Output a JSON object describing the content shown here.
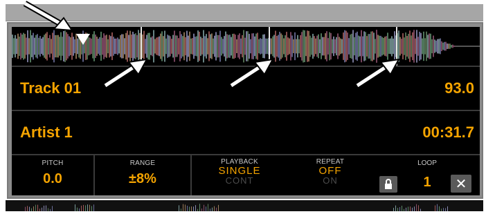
{
  "track": {
    "title": "Track 01",
    "bpm": "93.0"
  },
  "artist": {
    "name": "Artist 1",
    "time": "00:31.7"
  },
  "controls": {
    "pitch": {
      "label": "PITCH",
      "value": "0.0"
    },
    "range": {
      "label": "RANGE",
      "value": "±8%"
    },
    "playback": {
      "label": "PLAYBACK",
      "value": "SINGLE",
      "alt": "CONT"
    },
    "repeat": {
      "label": "REPEAT",
      "value": "OFF",
      "alt": "ON"
    },
    "loop": {
      "label": "LOOP",
      "value": "1"
    },
    "close_symbol": "✕"
  },
  "colors": {
    "accent": "#f5a400",
    "background": "#000000",
    "frame": "#8c8c8c"
  },
  "icons": [
    "lock-icon",
    "close-icon",
    "playhead-marker-icon",
    "annotation-arrow-icon"
  ]
}
